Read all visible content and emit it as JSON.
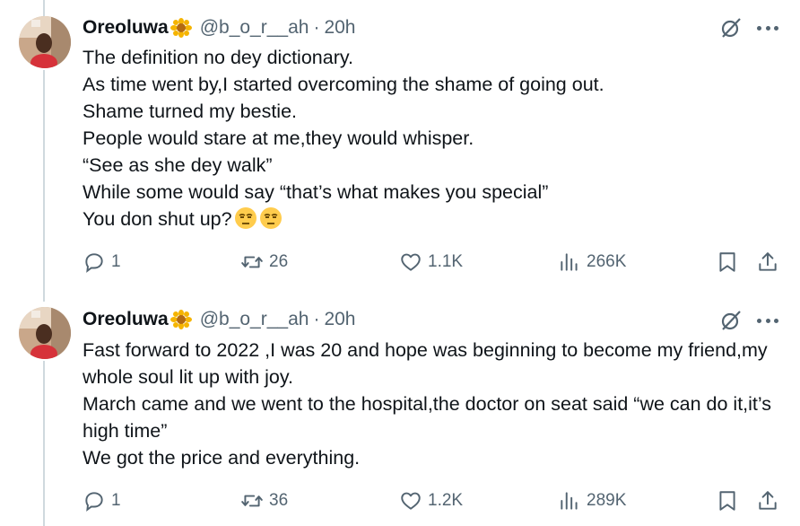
{
  "tweets": [
    {
      "author": {
        "name": "Oreoluwa",
        "handle": "@b_o_r__ah",
        "time": "20h"
      },
      "lines": [
        "The definition no dey dictionary.",
        "As time went by,I started overcoming the shame of going out.",
        "Shame turned my bestie.",
        "People would stare at me,they would whisper.",
        "“See as she dey walk”",
        "While some would say “that’s what makes you special”",
        "You don shut up?"
      ],
      "emoji": [
        "unamused-face",
        "unamused-face"
      ],
      "stats": {
        "replies": "1",
        "retweets": "26",
        "likes": "1.1K",
        "views": "266K"
      }
    },
    {
      "author": {
        "name": "Oreoluwa",
        "handle": "@b_o_r__ah",
        "time": "20h"
      },
      "lines": [
        "Fast forward to 2022 ,I was 20 and hope was beginning to become my friend,my whole soul lit up with joy.",
        "March came and we went to the hospital,the doctor on seat said “we can do it,it’s high time”",
        "We got the price and everything."
      ],
      "stats": {
        "replies": "1",
        "retweets": "36",
        "likes": "1.2K",
        "views": "289K"
      }
    }
  ],
  "separator": "·",
  "colors": {
    "text": "#0f1419",
    "secondary": "#536471",
    "thread_line": "#cfd9de",
    "flower": "#f5b400",
    "emoji": "#ffcc4d"
  },
  "icons": [
    "sunflower-emoji",
    "grok-icon",
    "more-icon",
    "reply-icon",
    "retweet-icon",
    "like-icon",
    "views-icon",
    "bookmark-icon",
    "share-icon"
  ]
}
